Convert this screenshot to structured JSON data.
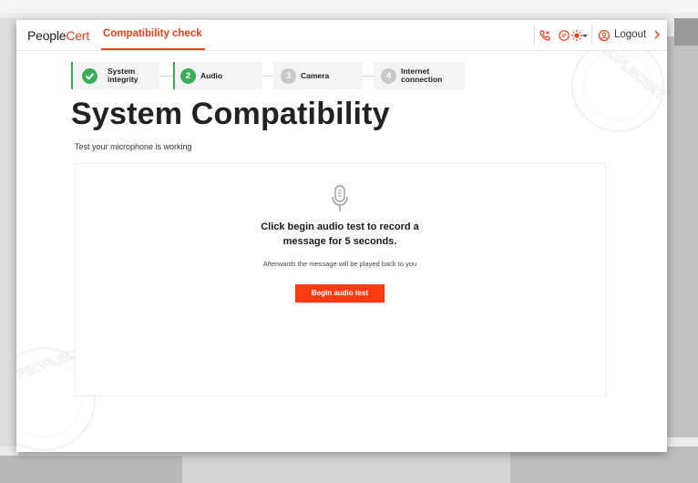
{
  "app": {
    "logo_main": "People",
    "logo_accent": "Cert",
    "nav_tab": "Compatibility check",
    "logout_label": "Logout"
  },
  "icons": {
    "phone": "phone-icon",
    "chat": "chat-icon",
    "theme": "sun-icon",
    "theme_menu": "chevron-down-icon",
    "user": "user-circle-icon",
    "logout_arrow": "chevron-right-icon",
    "mic": "microphone-icon",
    "check": "check-icon"
  },
  "stepper": {
    "steps": [
      {
        "number": "",
        "label_line1": "System",
        "label_line2": "integrity",
        "state": "done"
      },
      {
        "number": "2",
        "label_line1": "Audio",
        "label_line2": "",
        "state": "active"
      },
      {
        "number": "3",
        "label_line1": "Camera",
        "label_line2": "",
        "state": "pending"
      },
      {
        "number": "4",
        "label_line1": "Internet",
        "label_line2": "connection",
        "state": "pending"
      }
    ]
  },
  "main": {
    "title": "System Compatibility",
    "subtitle": "Test your microphone is working",
    "card": {
      "heading_line1": "Click begin audio test to record a",
      "heading_line2": "message for 5 seconds.",
      "note": "Afterwards the message will be played back to you",
      "button_label": "Begin audio test"
    }
  },
  "watermark_text": "PEOPLECERT",
  "colors": {
    "brand_orange": "#e8401c",
    "button": "#ff3b14",
    "success_green": "#3cae5a",
    "pending_gray": "#c9c9c9"
  }
}
